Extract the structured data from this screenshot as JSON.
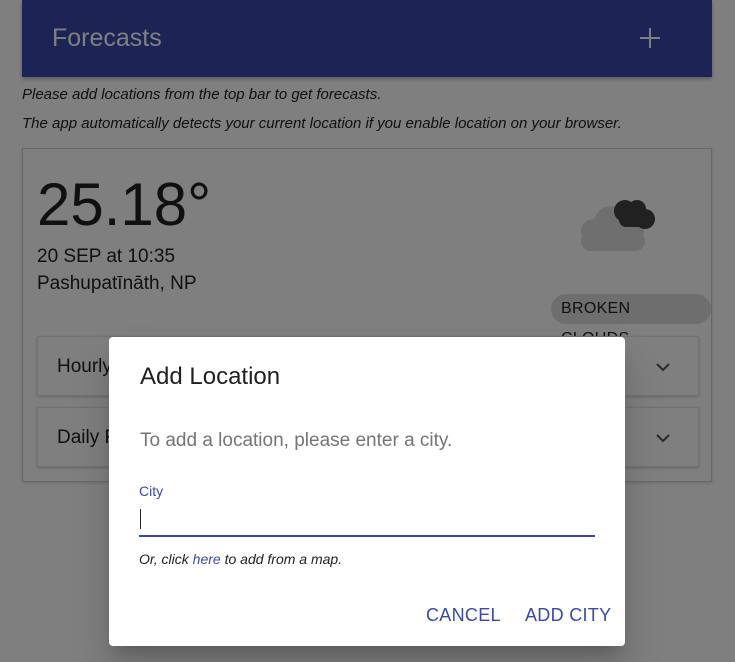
{
  "header": {
    "title": "Forecasts",
    "add_icon": "plus-icon"
  },
  "info": {
    "line1": "Please add locations from the top bar to get forecasts.",
    "line2": "The app automatically detects your current location if you enable location on your browser."
  },
  "weather": {
    "temperature": "25.18°",
    "date": "20 SEP at 10:35",
    "location": "Pashupatīnāth, NP",
    "condition": "BROKEN CLOUDS",
    "icon": "broken-clouds-icon",
    "panels": [
      {
        "label": "Hourly Forecast",
        "icon": "chevron-down-icon"
      },
      {
        "label": "Daily Forecast",
        "icon": "chevron-down-icon"
      }
    ]
  },
  "dialog": {
    "title": "Add Location",
    "text": "To add a location, please enter a city.",
    "field_label": "City",
    "field_value": "",
    "hint_before": "Or, click ",
    "hint_link": "here",
    "hint_after": " to add from a map.",
    "cancel_label": "CANCEL",
    "add_label": "ADD CITY"
  },
  "colors": {
    "primary": "#3949ab",
    "overlay": "rgba(0,0,0,0.5)",
    "badge": "#dcdcdc"
  }
}
